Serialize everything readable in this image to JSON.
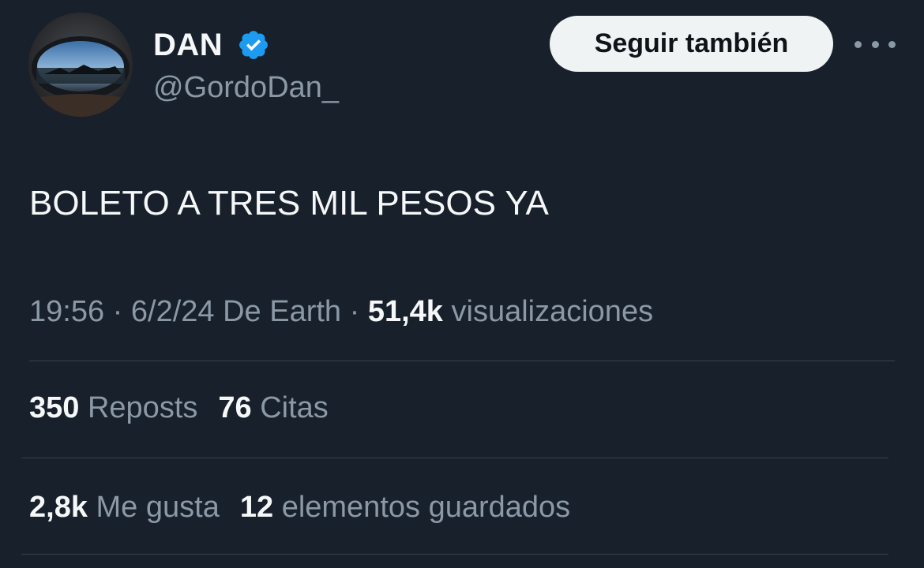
{
  "author": {
    "name": "DAN",
    "handle": "@GordoDan_",
    "verified": true,
    "verified_color": "#1d9bf0",
    "avatar_icon": "avatar-image"
  },
  "actions": {
    "follow_label": "Seguir también",
    "more_icon": "more-horizontal-icon"
  },
  "tweet": {
    "text": "BOLETO A TRES MIL PESOS YA"
  },
  "meta": {
    "time": "19:56",
    "separator": "·",
    "date": "6/2/24",
    "source": "De Earth",
    "views_count": "51,4k",
    "views_label": "visualizaciones"
  },
  "stats": {
    "reposts_count": "350",
    "reposts_label": "Reposts",
    "quotes_count": "76",
    "quotes_label": "Citas",
    "likes_count": "2,8k",
    "likes_label": "Me gusta",
    "bookmarks_count": "12",
    "bookmarks_label": "elementos guardados"
  },
  "colors": {
    "background": "#17202b",
    "text_primary": "#f5f7f8",
    "text_secondary": "#8b98a5",
    "divider": "#38444d",
    "button_bg": "#eff3f4"
  }
}
